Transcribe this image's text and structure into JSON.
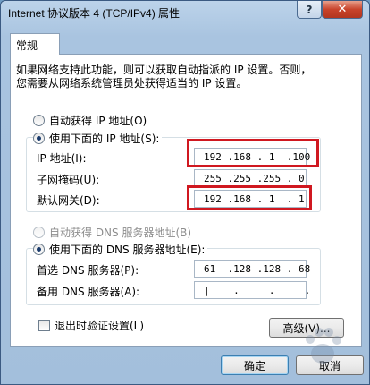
{
  "window": {
    "title": "Internet 协议版本 4 (TCP/IPv4) 属性",
    "help_label": "?",
    "close_label": "✕"
  },
  "tabs": [
    {
      "label": "常规"
    }
  ],
  "intro_lines": [
    "如果网络支持此功能，则可以获取自动指派的 IP 设置。否则，",
    "您需要从网络系统管理员处获得适当的 IP 设置。"
  ],
  "ip": {
    "auto_label": "自动获得 IP 地址(O)",
    "manual_label": "使用下面的 IP 地址(S):",
    "fields": [
      {
        "label": "IP 地址(I):",
        "value": "192 .168 . 1  .100"
      },
      {
        "label": "子网掩码(U):",
        "value": "255 .255 .255 . 0"
      },
      {
        "label": "默认网关(D):",
        "value": "192 .168 . 1  . 1"
      }
    ]
  },
  "dns": {
    "auto_label": "自动获得 DNS 服务器地址(B)",
    "manual_label": "使用下面的 DNS 服务器地址(E):",
    "fields": [
      {
        "label": "首选 DNS 服务器(P):",
        "value": "61  .128 .128 . 68"
      },
      {
        "label": "备用 DNS 服务器(A):",
        "value": "|    .     .     ."
      }
    ]
  },
  "validate_label": "退出时验证设置(L)",
  "advanced_label": "高级(V)...",
  "ok_label": "确定",
  "cancel_label": "取消",
  "colors": {
    "highlight_box": "#d01820"
  },
  "icons": {
    "watermark": "baidu-paw-icon"
  }
}
